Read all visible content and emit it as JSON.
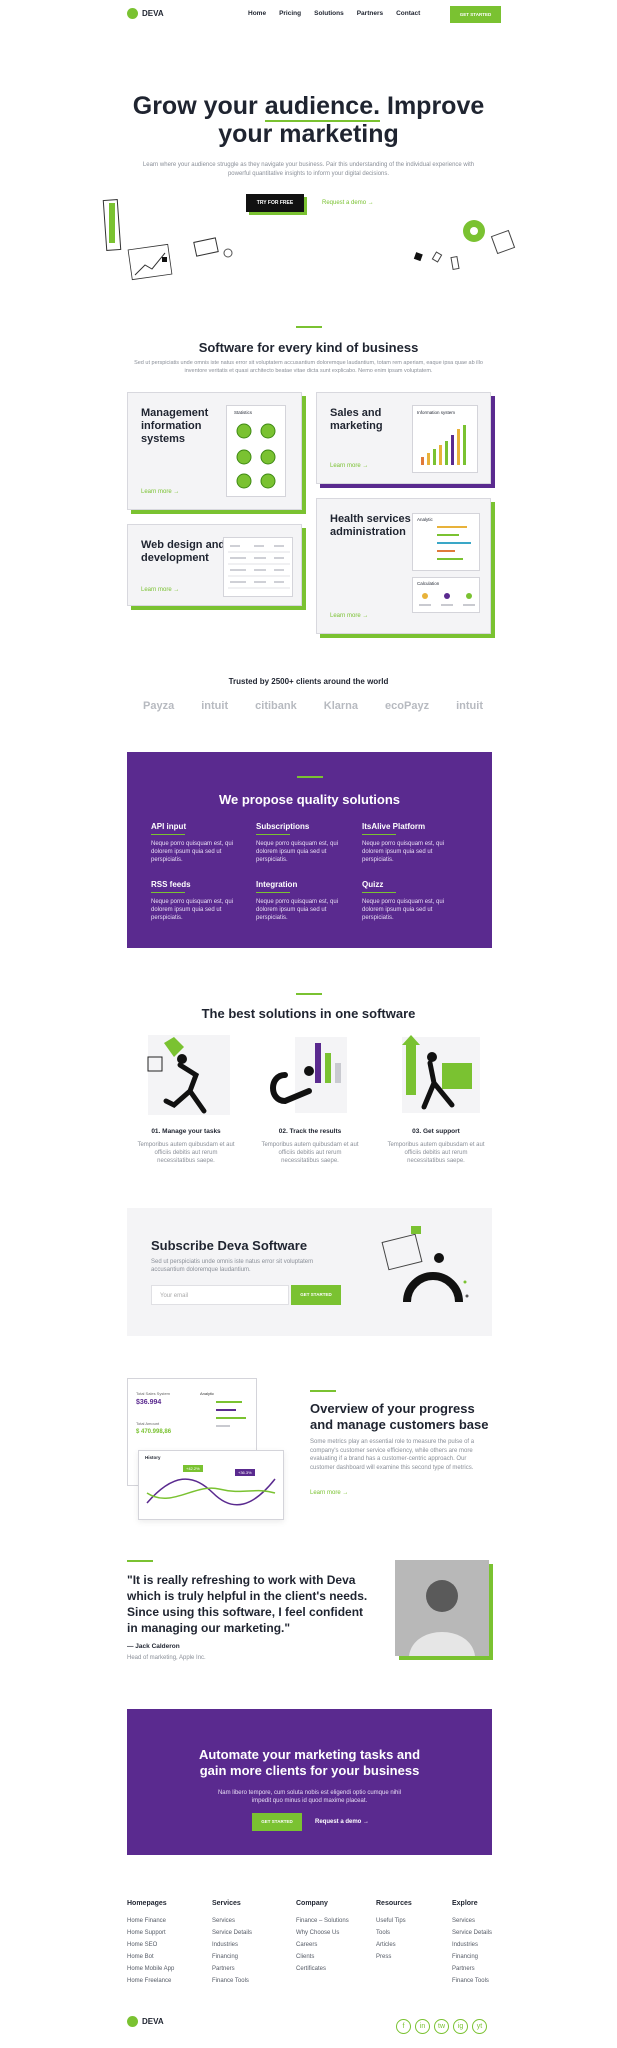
{
  "brand": {
    "name": "DEVA",
    "accent": "#7ac231",
    "purple": "#5a2a8f"
  },
  "nav": {
    "items": [
      "Home",
      "Pricing",
      "Solutions",
      "Partners",
      "Contact"
    ],
    "cta": "GET STARTED"
  },
  "hero": {
    "title_pre": "Grow your ",
    "title_em": "audience.",
    "title_post": " Improve",
    "title_line2": "your marketing",
    "desc": "Learn where your audience struggle as they navigate your business. Pair this understanding of the individual experience with powerful quantitative insights to inform your digital decisions.",
    "cta_primary": "TRY FOR FREE",
    "cta_secondary": "Request a demo →"
  },
  "software": {
    "title": "Software for every kind of business",
    "desc": "Sed ut perspiciatis unde omnis iste natus error sit voluptatem accusantium doloremque laudantium, totam rem aperiam, eaque ipsa quae ab illo inventore veritatis et quasi architecto beatae vitae dicta sunt explicabo. Nemo enim ipsam voluptatem.",
    "cards": [
      {
        "title": "Management information systems",
        "link": "Learn more →"
      },
      {
        "title": "Sales and marketing",
        "link": "Learn more →"
      },
      {
        "title": "Web design and development",
        "link": "Learn more →"
      },
      {
        "title": "Health services administration",
        "link": "Learn more →"
      }
    ],
    "mini": {
      "statistics": "Statistics",
      "info_system": "Information system",
      "analytic": "Analytic",
      "calculation": "Calculation"
    }
  },
  "clients": {
    "title": "Trusted by 2500+ clients around the world",
    "logos": [
      "Payza",
      "intuit",
      "citibank",
      "Klarna",
      "ecoPayz",
      "intuit"
    ]
  },
  "solutions": {
    "title": "We propose quality solutions",
    "items": [
      {
        "title": "API input",
        "text": "Neque porro quisquam est, qui dolorem ipsum quia sed ut perspiciatis."
      },
      {
        "title": "Subscriptions",
        "text": "Neque porro quisquam est, qui dolorem ipsum quia sed ut perspiciatis."
      },
      {
        "title": "ItsAlive Platform",
        "text": "Neque porro quisquam est, qui dolorem ipsum quia sed ut perspiciatis."
      },
      {
        "title": "RSS feeds",
        "text": "Neque porro quisquam est, qui dolorem ipsum quia sed ut perspiciatis."
      },
      {
        "title": "Integration",
        "text": "Neque porro quisquam est, qui dolorem ipsum quia sed ut perspiciatis."
      },
      {
        "title": "Quizz",
        "text": "Neque porro quisquam est, qui dolorem ipsum quia sed ut perspiciatis."
      }
    ]
  },
  "best": {
    "title": "The best solutions in one software",
    "steps": [
      {
        "title": "01. Manage your tasks",
        "text": "Temporibus autem quibusdam et aut officiis debitis aut rerum necessitatibus saepe."
      },
      {
        "title": "02. Track the results",
        "text": "Temporibus autem quibusdam et aut officiis debitis aut rerum necessitatibus saepe."
      },
      {
        "title": "03. Get support",
        "text": "Temporibus autem quibusdam et aut officiis debitis aut rerum necessitatibus saepe."
      }
    ]
  },
  "subscribe": {
    "title": "Subscribe Deva Software",
    "desc": "Sed ut perspiciatis unde omnis iste natus error sit voluptatem accusantium doloremque laudantium.",
    "placeholder": "Your email",
    "button": "GET STARTED"
  },
  "overview": {
    "title": "Overview of your progress and manage customers base",
    "desc": "Some metrics play an essential role to measure the pulse of a company's customer service efficiency, while others are more evaluating if a brand has a customer-centric approach. Our customer dashboard will examine this second type of metrics.",
    "link": "Learn more →",
    "dash": {
      "total_label": "Total Sales System",
      "total_value": "$36.994",
      "amount_label": "Total Amount",
      "amount_value": "$ 470.998,86",
      "analytic": "Analytic",
      "history": "History",
      "badge1": "+42.2%",
      "badge2": "+36.3%"
    }
  },
  "testimonial": {
    "quote": "\"It is really refreshing to work with Deva which is truly helpful in the client's needs. Since using this software, I feel confident in managing our marketing.\"",
    "author": "— Jack Calderon",
    "role": "Head of marketing, Apple Inc."
  },
  "cta_block": {
    "title": "Automate your marketing tasks and gain more clients for your business",
    "desc": "Nam libero tempore, cum soluta nobis est eligendi optio cumque nihil impedit quo minus id quod maxime placeat.",
    "primary": "GET STARTED",
    "secondary": "Request a demo →"
  },
  "footer": {
    "columns": [
      {
        "title": "Homepages",
        "items": [
          "Home Finance",
          "Home Support",
          "Home SEO",
          "Home Bot",
          "Home Mobile App",
          "Home Freelance"
        ]
      },
      {
        "title": "Services",
        "items": [
          "Services",
          "Service Details",
          "Industries",
          "Financing",
          "Partners",
          "Finance Tools"
        ]
      },
      {
        "title": "Company",
        "items": [
          "Finance – Solutions",
          "Why Choose Us",
          "Careers",
          "Clients",
          "Certificates"
        ]
      },
      {
        "title": "Resources",
        "items": [
          "Useful Tips",
          "Tools",
          "Articles",
          "Press"
        ]
      },
      {
        "title": "Explore",
        "items": [
          "Services",
          "Service Details",
          "Industries",
          "Financing",
          "Partners",
          "Finance Tools"
        ]
      }
    ],
    "brand": "DEVA",
    "socials": [
      "f",
      "in",
      "tw",
      "ig",
      "yt"
    ]
  }
}
